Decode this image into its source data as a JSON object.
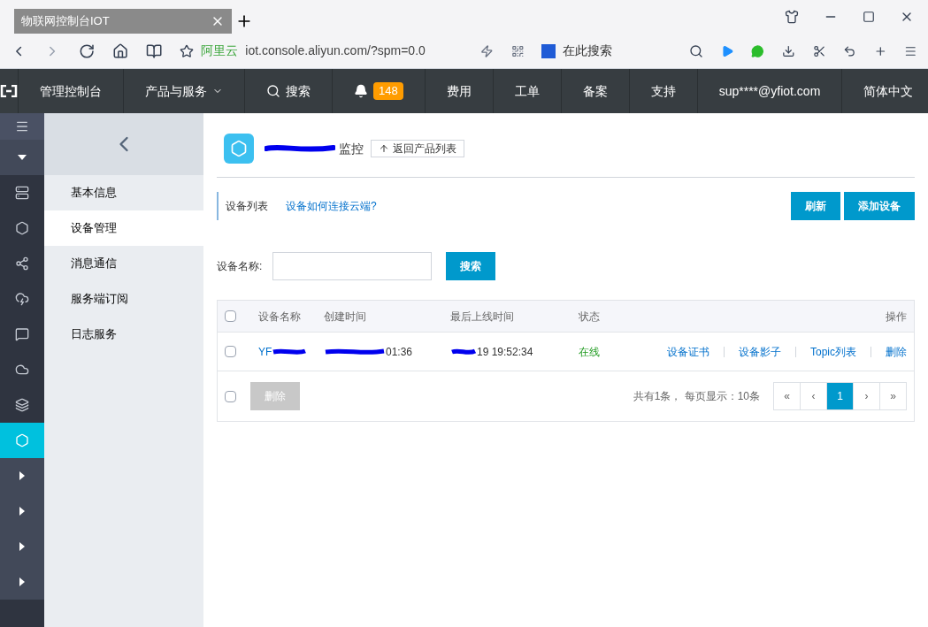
{
  "browser": {
    "tab_title": "物联网控制台IOT",
    "site_name": "阿里云",
    "url": "iot.console.aliyun.com/?spm=0.0",
    "search_placeholder": "在此搜索"
  },
  "topnav": {
    "items": [
      {
        "kind": "text",
        "label": "管理控制台"
      },
      {
        "kind": "dropdown",
        "label": "产品与服务"
      },
      {
        "kind": "search",
        "label": "搜索"
      },
      {
        "kind": "bell",
        "label": "148"
      },
      {
        "kind": "text",
        "label": "费用"
      },
      {
        "kind": "text",
        "label": "工单"
      },
      {
        "kind": "text",
        "label": "备案"
      },
      {
        "kind": "text",
        "label": "支持"
      },
      {
        "kind": "text",
        "label": "sup****@yfiot.com"
      },
      {
        "kind": "text",
        "label": "简体中文"
      }
    ]
  },
  "icon_sidebar": [
    {
      "kind": "menu",
      "selected": false
    },
    {
      "kind": "caret-down",
      "selected": false
    },
    {
      "kind": "server",
      "selected": false
    },
    {
      "kind": "blob",
      "selected": false
    },
    {
      "kind": "network",
      "selected": false
    },
    {
      "kind": "cloud-bolt",
      "selected": false
    },
    {
      "kind": "chat",
      "selected": false
    },
    {
      "kind": "cloud",
      "selected": false
    },
    {
      "kind": "stack",
      "selected": false
    },
    {
      "kind": "hex",
      "selected": true
    },
    {
      "kind": "caret-right",
      "selected": false
    },
    {
      "kind": "caret-right",
      "selected": false
    },
    {
      "kind": "caret-right",
      "selected": false
    },
    {
      "kind": "caret-right",
      "selected": false
    }
  ],
  "submenu": [
    {
      "label": "基本信息",
      "selected": false
    },
    {
      "label": "设备管理",
      "selected": true
    },
    {
      "label": "消息通信",
      "selected": false
    },
    {
      "label": "服务端订阅",
      "selected": false
    },
    {
      "label": "日志服务",
      "selected": false
    }
  ],
  "product": {
    "name": "监控",
    "back_button": "返回产品列表"
  },
  "section": {
    "title": "设备列表",
    "help_link": "设备如何连接云端?",
    "buttons": [
      "刷新",
      "添加设备"
    ]
  },
  "filter": {
    "label": "设备名称:",
    "search_button": "搜索"
  },
  "table": {
    "header_checked": false,
    "columns": [
      "设备名称",
      "创建时间",
      "最后上线时间",
      "状态",
      "操作"
    ],
    "rows": [
      {
        "checked": false,
        "name": "YF",
        "created": "01:36",
        "last_online": "19 19:52:34",
        "status": "在线",
        "actions": [
          "设备证书",
          "设备影子",
          "Topic列表",
          "删除"
        ]
      }
    ]
  },
  "footer": {
    "checked": false,
    "delete_button": "删除",
    "summary": "共有1条， 每页显示：10条",
    "pages": [
      {
        "label": "«",
        "selected": false
      },
      {
        "label": "‹",
        "selected": false
      },
      {
        "label": "1",
        "selected": true
      },
      {
        "label": "›",
        "selected": false
      },
      {
        "label": "»",
        "selected": false
      }
    ]
  }
}
